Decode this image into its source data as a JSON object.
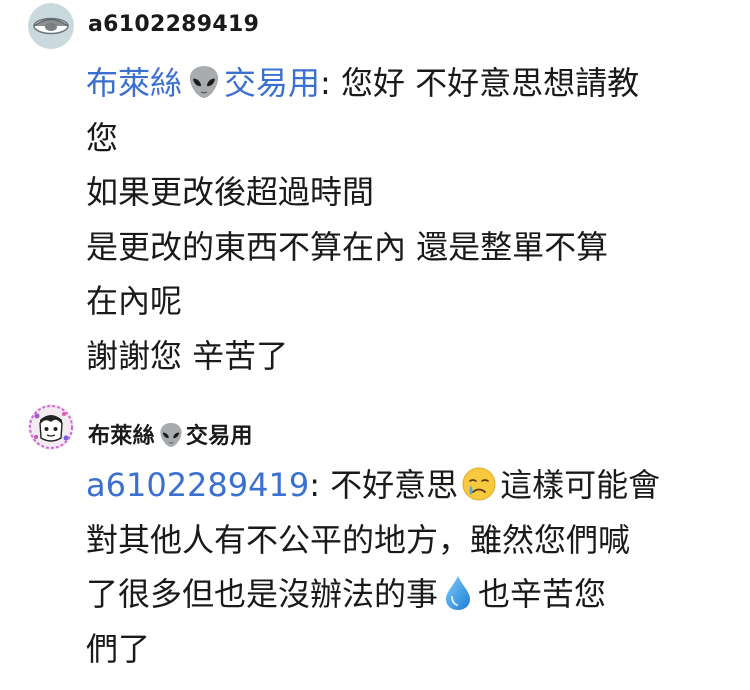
{
  "comments": [
    {
      "username": "a6102289419",
      "mention_name": "布萊絲",
      "mention_suffix": "交易用",
      "first_line_rest": ": 您好 不好意思想請教",
      "lines": [
        "您",
        "如果更改後超過時間",
        "是更改的東西不算在內 還是整單不算",
        "在內呢",
        "謝謝您 辛苦了"
      ],
      "avatar_icon": "grey-eye-avatar-icon"
    },
    {
      "username_name": "布萊絲",
      "username_suffix": "交易用",
      "mention": "a6102289419",
      "line1_text": ": 不好意思",
      "line1_tail": "這樣可能會",
      "line2": "對其他人有不公平的地方，雖然您們喊",
      "line3_text": "了很多但也是沒辦法的事",
      "line3_tail": "也辛苦您",
      "line4": "們了",
      "avatar_icon": "doodle-avatar-icon",
      "emojis": [
        "alien-icon",
        "crying-face-icon",
        "water-drop-icon"
      ]
    }
  ],
  "colors": {
    "mention": "#3b6fd0",
    "text": "#1a1a1a",
    "background": "#ffffff"
  }
}
